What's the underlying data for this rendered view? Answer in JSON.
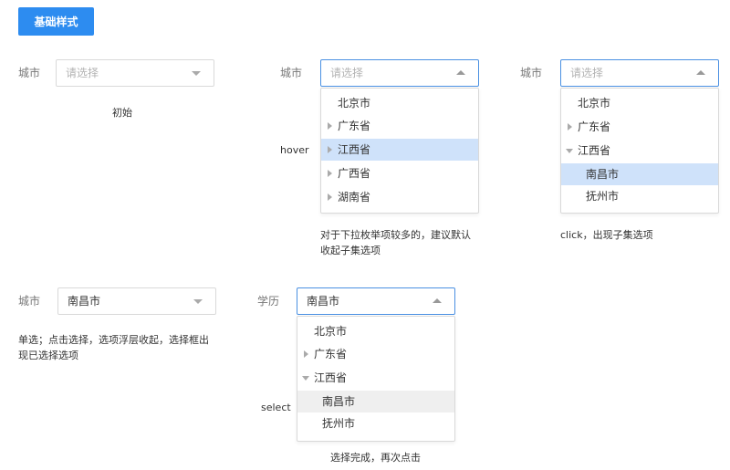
{
  "header": {
    "tag": "基础样式"
  },
  "label_city": "城市",
  "label_edu": "学历",
  "placeholder": "请选择",
  "selected_value": "南昌市",
  "options": {
    "beijing": "北京市",
    "guangdong": "广东省",
    "jiangxi": "江西省",
    "guangxi": "广西省",
    "hunan": "湖南省",
    "nanchang": "南昌市",
    "fuzhou": "抚州市"
  },
  "notes": {
    "initial": "初始",
    "hover": "hover",
    "hover_desc_line1": "对于下拉枚举项较多的，建议默认",
    "hover_desc_line2": "收起子集选项",
    "click_desc": "click，出现子集选项",
    "single_line1": "单选；点击选择，选项浮层收起，选择框出",
    "single_line2": "现已选择选项",
    "select": "select",
    "done": "选择完成，再次点击"
  },
  "colors": {
    "primary": "#2d8cf0",
    "hover_bg": "#cfe2fa",
    "selected_bg": "#efefef",
    "active_border": "#4a90e2"
  }
}
